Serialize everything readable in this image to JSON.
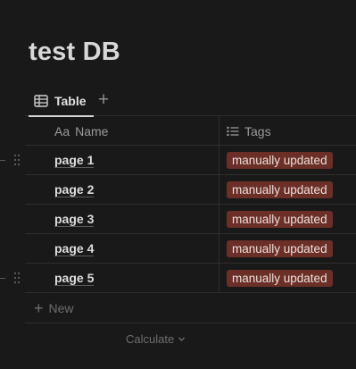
{
  "database": {
    "title": "test DB"
  },
  "views": {
    "active_label": "Table",
    "add_symbol": "+"
  },
  "columns": {
    "name": {
      "icon_text": "Aa",
      "label": "Name"
    },
    "tags": {
      "icon": "list-icon",
      "label": "Tags"
    }
  },
  "rows": [
    {
      "name": "page 1",
      "tag": "manually updated"
    },
    {
      "name": "page 2",
      "tag": "manually updated"
    },
    {
      "name": "page 3",
      "tag": "manually updated"
    },
    {
      "name": "page 4",
      "tag": "manually updated"
    },
    {
      "name": "page 5",
      "tag": "manually updated"
    }
  ],
  "footer": {
    "new_label": "New",
    "new_symbol": "+",
    "calculate_label": "Calculate"
  },
  "colors": {
    "tag_bg": "#6b2f28",
    "tag_text": "#eedfdb",
    "background": "#191919"
  }
}
